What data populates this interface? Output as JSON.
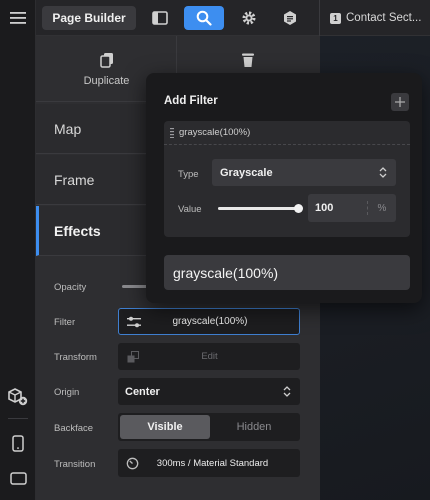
{
  "topbar": {
    "title": "Page Builder",
    "tab_label": "Contact Sect..."
  },
  "actions": {
    "duplicate": "Duplicate"
  },
  "sections": {
    "map": "Map",
    "frame": "Frame",
    "effects": "Effects"
  },
  "props": {
    "opacity_label": "Opacity",
    "filter_label": "Filter",
    "filter_value": "grayscale(100%)",
    "transform_label": "Transform",
    "transform_value": "Edit",
    "origin_label": "Origin",
    "origin_value": "Center",
    "backface_label": "Backface",
    "backface_options": [
      "Visible",
      "Hidden"
    ],
    "backface_selected": "Visible",
    "transition_label": "Transition",
    "transition_value": "300ms / Material Standard"
  },
  "popup": {
    "title": "Add Filter",
    "item_label": "grayscale(100%)",
    "type_label": "Type",
    "type_value": "Grayscale",
    "value_label": "Value",
    "value_number": "100",
    "value_unit": "%",
    "value_level": 1.0,
    "result": "grayscale(100%)"
  },
  "colors": {
    "accent": "#3d8ef0",
    "focus_border": "#3f7fd0",
    "panel": "#2e2e31"
  }
}
